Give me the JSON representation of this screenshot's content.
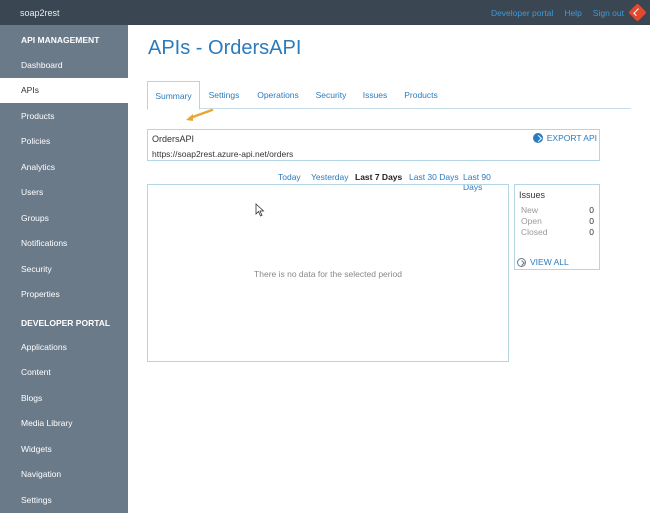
{
  "topbar": {
    "brand": "soap2rest",
    "links": [
      "Developer portal",
      "Help",
      "Sign out"
    ],
    "git_icon": "git-icon"
  },
  "sidebar": {
    "section_api": "API MANAGEMENT",
    "items_api": [
      "Dashboard",
      "APIs",
      "Products",
      "Policies",
      "Analytics",
      "Users",
      "Groups",
      "Notifications",
      "Security",
      "Properties"
    ],
    "active": "APIs",
    "section_dev": "DEVELOPER PORTAL",
    "items_dev": [
      "Applications",
      "Content",
      "Blogs",
      "Media Library",
      "Widgets",
      "Navigation",
      "Settings"
    ]
  },
  "main": {
    "title": "APIs - OrdersAPI",
    "tabs": [
      "Summary",
      "Settings",
      "Operations",
      "Security",
      "Issues",
      "Products"
    ],
    "active_tab": "Summary",
    "api": {
      "name": "OrdersAPI",
      "url": "https://soap2rest.azure-api.net/orders",
      "export_label": "EXPORT API"
    },
    "periods": [
      "Today",
      "Yesterday",
      "Last 7 Days",
      "Last 30 Days",
      "Last 90 Days"
    ],
    "active_period": "Last 7 Days",
    "chart_empty": "There is no data for the selected period",
    "issues": {
      "title": "Issues",
      "rows": [
        {
          "label": "New",
          "count": "0"
        },
        {
          "label": "Open",
          "count": "0"
        },
        {
          "label": "Closed",
          "count": "0"
        }
      ],
      "view_all": "VIEW ALL"
    }
  },
  "colors": {
    "topbar": "#3b4653",
    "sidebar": "#6b7a89",
    "accent": "#2b7bbd",
    "border": "#b5d5e6",
    "arrow": "#e8a636"
  }
}
